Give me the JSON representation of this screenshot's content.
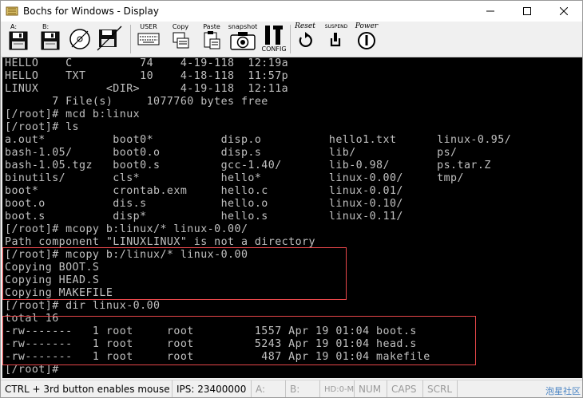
{
  "window": {
    "title": "Bochs for Windows - Display"
  },
  "toolbar": {
    "buttons": [
      {
        "label": "A:",
        "icon": "floppy-a-icon"
      },
      {
        "label": "B:",
        "icon": "floppy-b-icon"
      },
      {
        "label": "CD",
        "icon": "cdrom-icon"
      },
      {
        "label": "",
        "icon": "floppy-c-disabled-icon"
      },
      {
        "label": "USER",
        "icon": "user-keyboard-icon"
      },
      {
        "label": "Copy",
        "icon": "copy-icon"
      },
      {
        "label": "Paste",
        "icon": "paste-icon"
      },
      {
        "label": "snapshot",
        "icon": "camera-icon"
      },
      {
        "label": "CONFIG",
        "icon": "config-icon"
      },
      {
        "label": "Reset",
        "icon": "reset-icon"
      },
      {
        "label": "SUSPEND",
        "icon": "suspend-icon"
      },
      {
        "label": "Power",
        "icon": "power-icon"
      }
    ]
  },
  "terminal": {
    "lines": [
      "HELLO    C          74    4-19-118  12:19a",
      "HELLO    TXT        10    4-18-118  11:57p",
      "LINUX          <DIR>      4-19-118  12:11a",
      "       7 File(s)     1077760 bytes free",
      "[/root]# mcd b:linux",
      "[/root]# ls",
      "a.out*          boot0*          disp.o          hello1.txt      linux-0.95/",
      "bash-1.05/      boot0.o         disp.s          lib/            ps/",
      "bash-1.05.tgz   boot0.s         gcc-1.40/       lib-0.98/       ps.tar.Z",
      "binutils/       cls*            hello*          linux-0.00/     tmp/",
      "boot*           crontab.exm     hello.c         linux-0.01/",
      "boot.o          dis.s           hello.o         linux-0.10/",
      "boot.s          disp*           hello.s         linux-0.11/",
      "[/root]# mcopy b:linux/* linux-0.00/",
      "Path component \"LINUXLINUX\" is not a directory",
      "[/root]# mcopy b:/linux/* linux-0.00",
      "Copying BOOT.S",
      "Copying HEAD.S",
      "Copying MAKEFILE",
      "[/root]# dir linux-0.00",
      "total 16",
      "-rw-------   1 root     root         1557 Apr 19 01:04 boot.s",
      "-rw-------   1 root     root         5243 Apr 19 01:04 head.s",
      "-rw-------   1 root     root          487 Apr 19 01:04 makefile",
      "[/root]#"
    ]
  },
  "statusbar": {
    "hint": "CTRL + 3rd button enables mouse",
    "ips": "IPS: 23400000",
    "a": "A:",
    "b": "B:",
    "hd": "HD:0-M",
    "num": "NUM",
    "caps": "CAPS",
    "scrl": "SCRL"
  },
  "watermark": "泡星社区",
  "colors": {
    "terminal_bg": "#000000",
    "terminal_fg": "#c0c0c0",
    "highlight_box": "#e8474a"
  }
}
